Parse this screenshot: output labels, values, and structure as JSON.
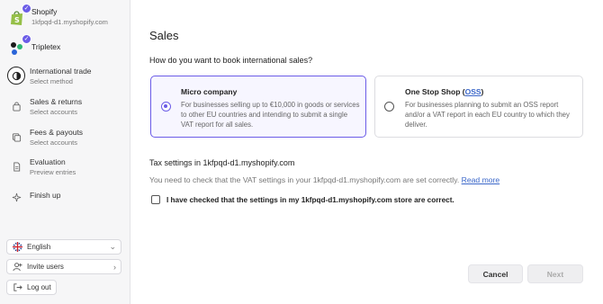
{
  "sidebar": {
    "connections": [
      {
        "name": "Shopify",
        "subtitle": "1kfpqd-d1.myshopify.com"
      },
      {
        "name": "Tripletex",
        "subtitle": ""
      }
    ],
    "steps": [
      {
        "title": "International trade",
        "subtitle": "Select method",
        "icon": "globe-icon",
        "active": true
      },
      {
        "title": "Sales & returns",
        "subtitle": "Select accounts",
        "icon": "shopping-bag-icon",
        "active": false
      },
      {
        "title": "Fees & payouts",
        "subtitle": "Select accounts",
        "icon": "coins-icon",
        "active": false
      },
      {
        "title": "Evaluation",
        "subtitle": "Preview entries",
        "icon": "document-icon",
        "active": false
      },
      {
        "title": "Finish up",
        "subtitle": "",
        "icon": "sparkle-icon",
        "active": false
      }
    ],
    "language": {
      "label": "English",
      "icon": "uk-flag-icon"
    },
    "invite": {
      "label": "Invite users"
    },
    "logout": {
      "label": "Log out"
    }
  },
  "main": {
    "title": "Sales",
    "question": "How do you want to book international sales?",
    "options": [
      {
        "title": "Micro company",
        "description": "For businesses selling up to €10,000 in goods or services to other EU countries and intending to submit a single VAT report for all sales.",
        "selected": true
      },
      {
        "title_prefix": "One Stop Shop (",
        "title_link": "OSS",
        "title_suffix": ")",
        "description": "For businesses planning to submit an OSS report and/or a VAT report in each EU country to which they deliver.",
        "selected": false
      }
    ],
    "tax_heading": "Tax settings in 1kfpqd-d1.myshopify.com",
    "tax_text": "You need to check that the VAT settings in your 1kfpqd-d1.myshopify.com are set correctly.",
    "read_more": "Read more",
    "confirm_label": "I have checked that the settings in my 1kfpqd-d1.myshopify.com store are correct.",
    "cancel_label": "Cancel",
    "next_label": "Next"
  },
  "colors": {
    "accent": "#6b5ce7",
    "link": "#3b67c9",
    "sidebar_bg": "#f6f6f7"
  }
}
